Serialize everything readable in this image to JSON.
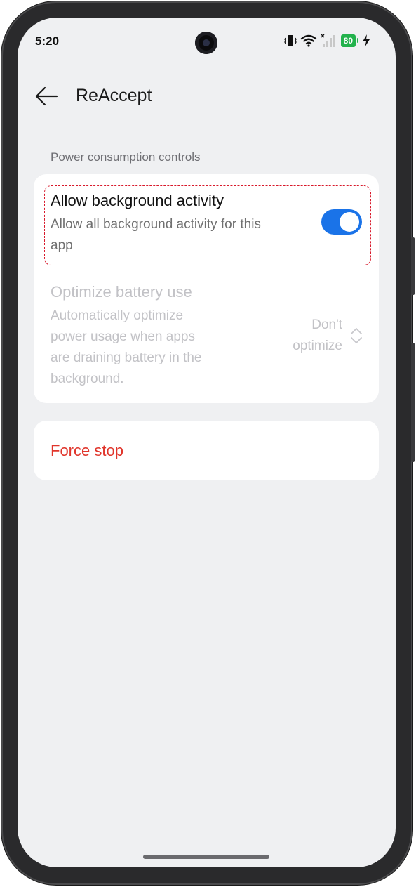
{
  "status_bar": {
    "time": "5:20",
    "battery_level": "80",
    "icons": [
      "vibrate-icon",
      "wifi-icon",
      "signal-icon",
      "battery-icon",
      "charging-icon"
    ]
  },
  "app_bar": {
    "title": "ReAccept",
    "back_icon": "back-arrow-icon"
  },
  "section": {
    "header": "Power consumption controls"
  },
  "settings": {
    "background_activity": {
      "title": "Allow background activity",
      "subtitle_line1": "Allow all background activity for this",
      "subtitle_line2": "app",
      "enabled": true
    },
    "battery_optimization": {
      "title": "Optimize battery use",
      "subtitle_line1": "Automatically optimize",
      "subtitle_line2": "power usage when apps",
      "subtitle_line3": "are draining battery in the",
      "subtitle_line4": "background.",
      "value_line1": "Don't",
      "value_line2": "optimize",
      "disabled": true
    }
  },
  "force_stop": {
    "label": "Force stop"
  },
  "colors": {
    "accent": "#1a73e8",
    "destructive": "#e0352b",
    "highlight_border": "#d8182a",
    "battery": "#22b24c",
    "background": "#eff0f2"
  }
}
